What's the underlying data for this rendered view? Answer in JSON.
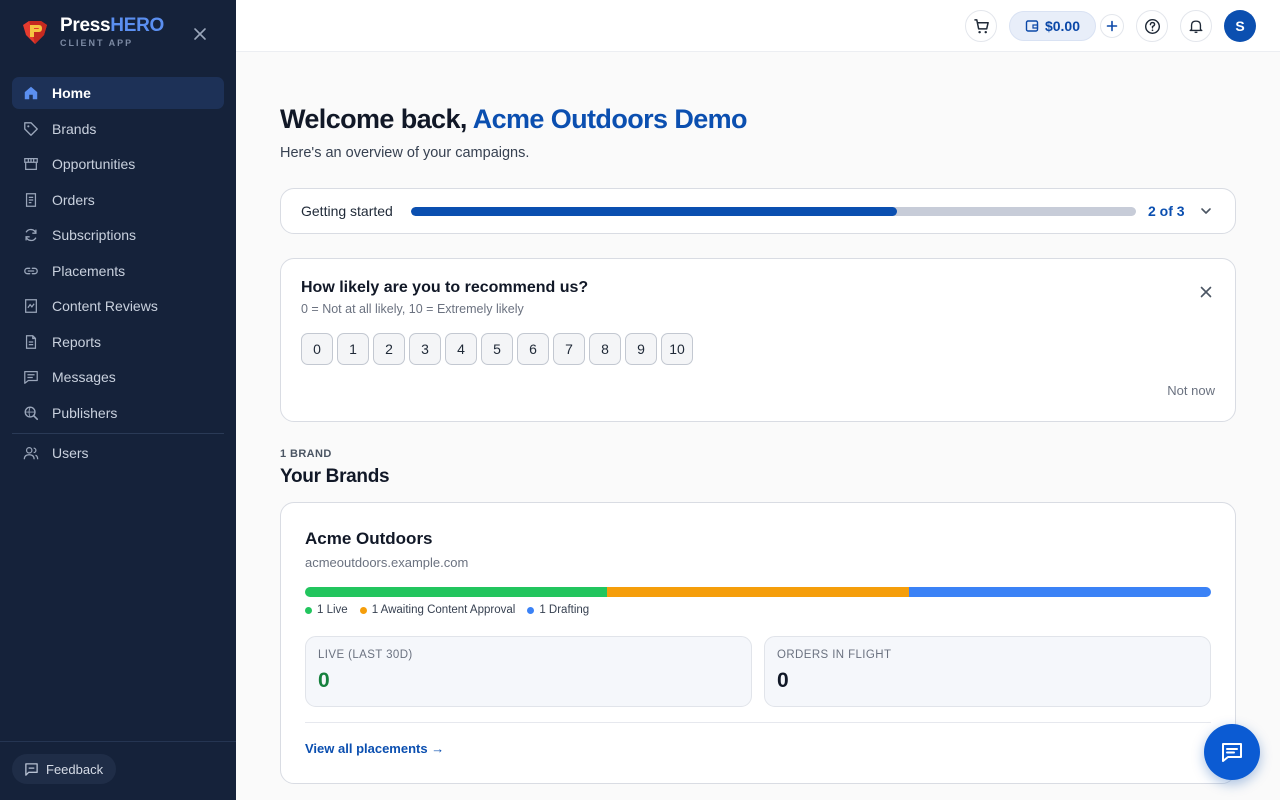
{
  "app": {
    "name_part1": "Press",
    "name_part2": "HERO",
    "subtitle": "CLIENT APP",
    "accent": "#0b4fb0"
  },
  "sidebar": {
    "items": [
      {
        "label": "Home",
        "icon": "home-icon",
        "active": true
      },
      {
        "label": "Brands",
        "icon": "tag-icon"
      },
      {
        "label": "Opportunities",
        "icon": "store-icon"
      },
      {
        "label": "Orders",
        "icon": "receipt-icon"
      },
      {
        "label": "Subscriptions",
        "icon": "refresh-icon"
      },
      {
        "label": "Placements",
        "icon": "link-icon"
      },
      {
        "label": "Content Reviews",
        "icon": "review-icon"
      },
      {
        "label": "Reports",
        "icon": "report-icon"
      },
      {
        "label": "Messages",
        "icon": "message-icon"
      },
      {
        "label": "Publishers",
        "icon": "search-globe-icon"
      }
    ],
    "secondary_items": [
      {
        "label": "Users",
        "icon": "users-icon"
      }
    ],
    "feedback_label": "Feedback"
  },
  "header": {
    "balance": "$0.00",
    "avatar_initial": "S"
  },
  "main": {
    "welcome_prefix": "Welcome back,",
    "org_name": "Acme Outdoors Demo",
    "subtitle": "Here's an overview of your campaigns."
  },
  "getting_started": {
    "label": "Getting started",
    "progress": 0.67,
    "count_text": "2 of 3"
  },
  "nps": {
    "title": "How likely are you to recommend us?",
    "subtitle": "0 = Not at all likely, 10 = Extremely likely",
    "scale": [
      "0",
      "1",
      "2",
      "3",
      "4",
      "5",
      "6",
      "7",
      "8",
      "9",
      "10"
    ],
    "dismiss_label": "Not now"
  },
  "brands_section": {
    "count_label": "1 BRAND",
    "heading": "Your Brands"
  },
  "brand_card": {
    "name": "Acme Outdoors",
    "domain": "acmeoutdoors.example.com",
    "status_breakdown": [
      {
        "label": "1 Live",
        "count": 1,
        "color": "#22c55e"
      },
      {
        "label": "1 Awaiting Content Approval",
        "count": 1,
        "color": "#f59e0b"
      },
      {
        "label": "1 Drafting",
        "count": 1,
        "color": "#3b82f6"
      }
    ],
    "stats": {
      "live_label": "LIVE (LAST 30D)",
      "live_value": "0",
      "live_color": "#15803d",
      "orders_label": "ORDERS IN FLIGHT",
      "orders_value": "0"
    },
    "link_label": "View all placements →"
  }
}
